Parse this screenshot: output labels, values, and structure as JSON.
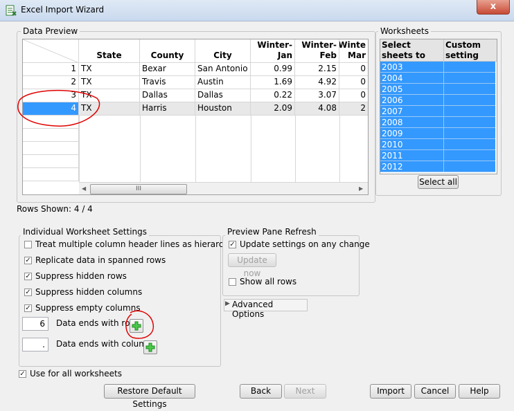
{
  "window": {
    "title": "Excel Import Wizard",
    "close_label": "x"
  },
  "data_preview": {
    "label": "Data Preview",
    "columns": [
      {
        "h1": "",
        "h2": "State"
      },
      {
        "h1": "",
        "h2": "County"
      },
      {
        "h1": "",
        "h2": "City"
      },
      {
        "h1": "Winter-",
        "h2": "Jan"
      },
      {
        "h1": "Winter-",
        "h2": "Feb"
      },
      {
        "h1": "Winte",
        "h2": "Mar"
      }
    ],
    "rows": [
      {
        "num": "1",
        "cells": [
          "TX",
          "Bexar",
          "San Antonio",
          "0.99",
          "2.15",
          "0"
        ]
      },
      {
        "num": "2",
        "cells": [
          "TX",
          "Travis",
          "Austin",
          "1.69",
          "4.92",
          "0"
        ]
      },
      {
        "num": "3",
        "cells": [
          "TX",
          "Dallas",
          "Dallas",
          "0.22",
          "3.07",
          "0"
        ]
      },
      {
        "num": "4",
        "cells": [
          "TX",
          "Harris",
          "Houston",
          "2.09",
          "4.08",
          "2"
        ]
      }
    ],
    "scroll_grip": "III",
    "rows_shown": "Rows Shown: 4 / 4"
  },
  "worksheets": {
    "label": "Worksheets",
    "col1": "Select sheets to open",
    "col1_a": "Select",
    "col1_b": "sheets to open",
    "col2_a": "Custom",
    "col2_b": "setting",
    "items": [
      "2003",
      "2004",
      "2005",
      "2006",
      "2007",
      "2008",
      "2009",
      "2010",
      "2011",
      "2012"
    ],
    "select_all": "Select all"
  },
  "individual": {
    "label": "Individual Worksheet Settings",
    "options": [
      {
        "label": "Treat multiple column header lines as hierarchies",
        "checked": false
      },
      {
        "label": "Replicate data in spanned rows",
        "checked": true
      },
      {
        "label": "Suppress hidden rows",
        "checked": true
      },
      {
        "label": "Suppress hidden columns",
        "checked": true
      },
      {
        "label": "Suppress empty columns",
        "checked": true
      }
    ],
    "ends_row_value": "6",
    "ends_row_label": "Data ends with row",
    "ends_col_value": ".",
    "ends_col_label": "Data ends with column"
  },
  "preview_refresh": {
    "label": "Preview Pane Refresh",
    "update_label": "Update settings on any change",
    "update_now": "Update now",
    "show_all": "Show all rows"
  },
  "advanced": "Advanced Options",
  "use_all": "Use for all worksheets",
  "buttons": {
    "restore": "Restore Default Settings",
    "back": "Back",
    "next": "Next",
    "import": "Import",
    "cancel": "Cancel",
    "help": "Help"
  },
  "colors": {
    "selection": "#3399ff",
    "annotation": "#e00000",
    "plus": "#22aa22"
  }
}
